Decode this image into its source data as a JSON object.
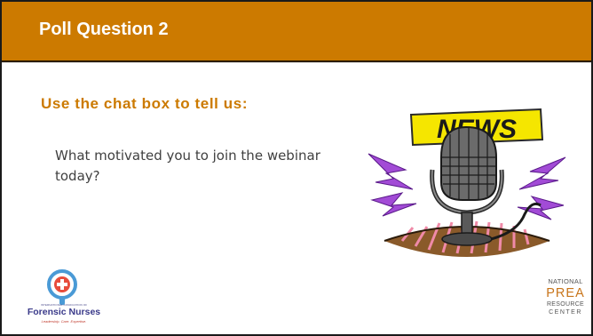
{
  "slide": {
    "title": "Poll Question 2",
    "heading": "Use the chat box to tell us:",
    "body": "What motivated you to join the webinar today?"
  },
  "clipart": {
    "sign_text": "NEWS",
    "icon": "news-microphone-clipart"
  },
  "logos": {
    "iafn": {
      "small_text": "INTERNATIONAL ASSOCIATION OF",
      "name": "Forensic Nurses",
      "tagline": "Leadership. Care. Expertise.",
      "icon": "magnifying-glass-cross-icon"
    },
    "prea": {
      "line1": "NATIONAL",
      "line2": "PREA",
      "line3": "RESOURCE",
      "line4": "CENTER"
    }
  },
  "colors": {
    "title_bar": "#cc7a00",
    "title_text": "#ffffff",
    "heading": "#cc7a00",
    "body_text": "#404040",
    "prea_accent": "#c8751a"
  }
}
